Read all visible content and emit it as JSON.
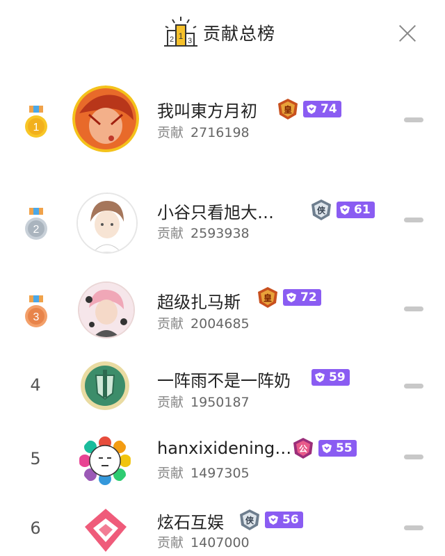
{
  "header": {
    "title": "贡献总榜",
    "close_icon": "close-icon"
  },
  "contribution_label": "贡献",
  "colors": {
    "level_badge": "#8a5cf2",
    "gold": "#f4b400",
    "silver": "#aab4be",
    "bronze": "#e8844a"
  },
  "rows": [
    {
      "rank": "1",
      "name": "我叫東方月初",
      "score": "2716198",
      "emblem": "皇",
      "level": "74"
    },
    {
      "rank": "2",
      "name": "小谷只看旭大…",
      "score": "2593938",
      "emblem": "侠",
      "level": "61"
    },
    {
      "rank": "3",
      "name": "超级扎马斯",
      "score": "2004685",
      "emblem": "皇",
      "level": "72"
    },
    {
      "rank": "4",
      "name": "一阵雨不是一阵奶",
      "score": "1950187",
      "emblem": "",
      "level": "59"
    },
    {
      "rank": "5",
      "name": "hanxixidening…",
      "score": "1497305",
      "emblem": "公",
      "level": "55"
    },
    {
      "rank": "6",
      "name": "炫石互娱",
      "score": "1407000",
      "emblem": "侠",
      "level": "56"
    }
  ]
}
